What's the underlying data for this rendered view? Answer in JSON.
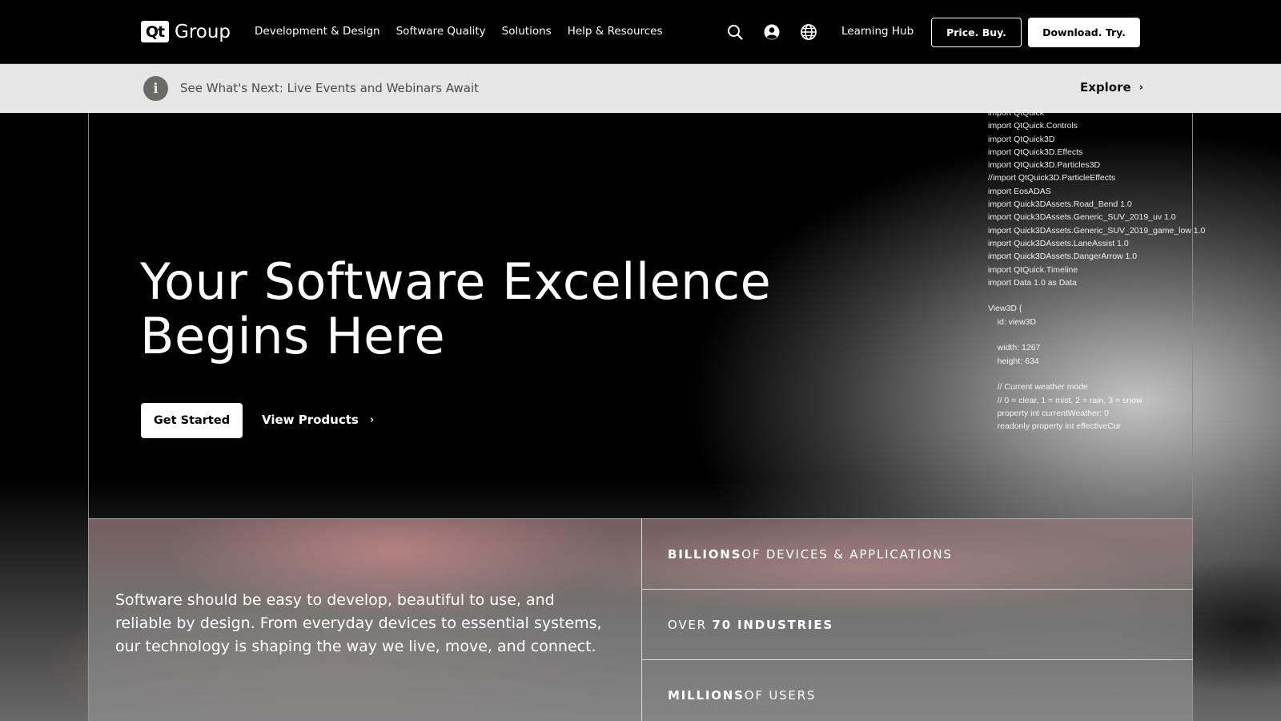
{
  "header": {
    "logo_mark": "Qt",
    "logo_text": "Group",
    "nav": [
      {
        "label": "Development & Design"
      },
      {
        "label": "Software Quality"
      },
      {
        "label": "Solutions"
      },
      {
        "label": "Help & Resources"
      }
    ],
    "icons": [
      "search-icon",
      "account-icon",
      "globe-icon"
    ],
    "learning_hub": "Learning Hub",
    "price_buy": "Price. Buy.",
    "download_try": "Download. Try."
  },
  "announcement": {
    "icon": "info-icon",
    "icon_glyph": "i",
    "text": "See What's Next: Live Events and Webinars Await",
    "link": "Explore",
    "link_chevron": "›"
  },
  "hero": {
    "title_line1": "Your Software Excellence",
    "title_line2": "Begins Here",
    "primary_cta": "Get Started",
    "secondary_cta": "View Products",
    "secondary_chevron": "›",
    "code_lines": [
      "import QtQuick",
      "import QtQuick.Controls",
      "import QtQuick3D",
      "import QtQuick3D.Effects",
      "import QtQuick3D.Particles3D",
      "//import QtQuick3D.ParticleEffects",
      "import EosADAS",
      "import Quick3DAssets.Road_Bend 1.0",
      "import Quick3DAssets.Generic_SUV_2019_uv 1.0",
      "import Quick3DAssets.Generic_SUV_2019_game_low 1.0",
      "import Quick3DAssets.LaneAssist 1.0",
      "import Quick3DAssets.DangerArrow 1.0",
      "import QtQuick.Timeline",
      "import Data 1.0 as Data",
      "",
      "View3D {",
      "    id: view3D",
      "",
      "    width: 1267",
      "    height: 634",
      "",
      "    // Current weather mode",
      "    // 0 = clear, 1 = mist, 2 = rain, 3 = snow",
      "    property int currentWeather: 0",
      "    readonly property int effectiveCur"
    ]
  },
  "stats": {
    "description": "Software should be easy to develop, beautiful to use, and reliable by design. From everyday devices to essential systems, our technology is shaping the way we live, move, and connect.",
    "rows": [
      {
        "bold": "BILLIONS",
        "rest": " OF DEVICES & APPLICATIONS"
      },
      {
        "pre": "OVER ",
        "bold": "70 INDUSTRIES"
      },
      {
        "bold": "MILLIONS",
        "rest": " OF USERS"
      }
    ]
  },
  "colors": {
    "header_bg": "#000000",
    "announce_bg": "#e6e6e6",
    "accent": "#ffffff"
  }
}
